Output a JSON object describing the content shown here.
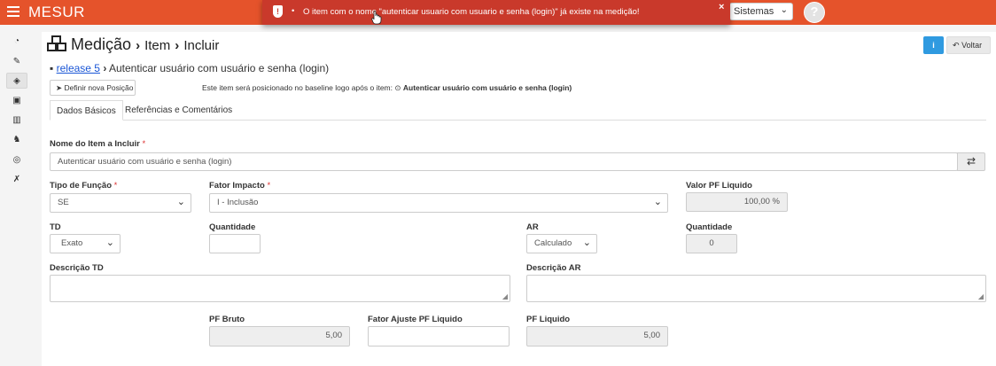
{
  "topbar": {
    "brand": "MESUR",
    "systems_select": "Sistemas",
    "help_icon_text": "?"
  },
  "toast": {
    "bullet": "•",
    "message": "O item com o nome \"autenticar usuario com usuario e senha (login)\" já existe na medição!",
    "close": "×"
  },
  "sidebar": {
    "items": [
      {
        "icon": "dashboard-icon",
        "glyph": "◔"
      },
      {
        "icon": "pencil-icon",
        "glyph": "✎"
      },
      {
        "icon": "cubes-icon",
        "glyph": "◈"
      },
      {
        "icon": "image-icon",
        "glyph": "▣"
      },
      {
        "icon": "bank-icon",
        "glyph": "▥"
      },
      {
        "icon": "sitemap-icon",
        "glyph": "♞"
      },
      {
        "icon": "target-icon",
        "glyph": "◎"
      },
      {
        "icon": "wrench-icon",
        "glyph": "✗"
      }
    ]
  },
  "header": {
    "title": "Medição",
    "crumb_sep": "›",
    "crumb1": "Item",
    "crumb2": "Incluir",
    "info_button": "i",
    "back_button": "Voltar"
  },
  "context": {
    "release_link": "release 5",
    "item_title": "Autenticar usuário com usuário e senha (login)",
    "define_position_button": "Definir nova Posição",
    "position_note": "Este item será posicionado no baseline logo após o item:",
    "position_item": "Autenticar usuário com usuário e senha (login)"
  },
  "tabs": [
    {
      "label": "Dados Básicos",
      "active": true
    },
    {
      "label": "Referências e Comentários",
      "active": false
    }
  ],
  "form": {
    "nome_label": "Nome do Item a Incluir",
    "nome_value": "Autenticar usuário com usuário e senha (login)",
    "tipo_funcao_label": "Tipo de Função",
    "tipo_funcao_value": "SE",
    "fator_impacto_label": "Fator Impacto",
    "fator_impacto_value": "I - Inclusão",
    "valor_pf_liquido_label": "Valor PF Liquido",
    "valor_pf_liquido_value": "100,00 %",
    "td_label": "TD",
    "td_value": "Exato",
    "quantidade_td_label": "Quantidade",
    "quantidade_td_value": "",
    "ar_label": "AR",
    "ar_value": "Calculado",
    "quantidade_ar_label": "Quantidade",
    "quantidade_ar_value": "0",
    "descricao_td_label": "Descrição TD",
    "descricao_ar_label": "Descrição AR",
    "pf_bruto_label": "PF Bruto",
    "pf_bruto_value": "5,00",
    "fator_ajuste_label": "Fator Ajuste PF Liquido",
    "fator_ajuste_value": "",
    "pf_liquido_label": "PF Liquido",
    "pf_liquido_value": "5,00",
    "required_mark": "*"
  },
  "colors": {
    "topbar": "#e5532b",
    "toast": "#c9392b",
    "info_button": "#2f9ae0",
    "link": "#1a56d6"
  }
}
